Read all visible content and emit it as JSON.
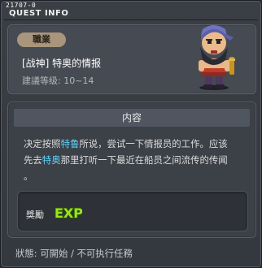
{
  "window": {
    "quest_id": "21707-0",
    "title": "QUEST INFO"
  },
  "header": {
    "job_tag": "職業",
    "quest_name": "[战神] 特奥的情报",
    "level_range": "建議等级: 10~14"
  },
  "content": {
    "heading": "内容",
    "lines": [
      [
        "决定按照",
        "特鲁",
        "所说，尝试一下情报员的工作。应该"
      ],
      [
        "先去",
        "特奥",
        "那里打听一下最近在船员之间流传的传闻"
      ],
      [
        "。",
        "",
        ""
      ]
    ]
  },
  "reward": {
    "label": "獎勵",
    "items": [
      {
        "icon": "exp-icon",
        "text": "EXP"
      }
    ]
  },
  "status": "狀態: 可開始 / 不可执行任務",
  "colors": {
    "highlight": "#5fd3ff",
    "exp_green": "#9be31e"
  }
}
